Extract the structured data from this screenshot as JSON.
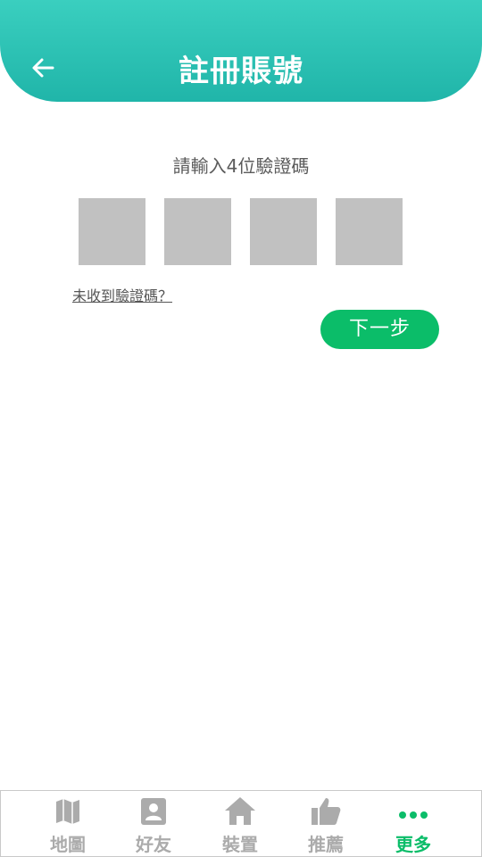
{
  "header": {
    "title": "註冊賬號",
    "back_icon": "arrow-left-icon"
  },
  "verify": {
    "prompt": "請輸入4位驗證碼",
    "code_digits": [
      "",
      "",
      "",
      ""
    ],
    "resend_link": "未收到驗證碼？",
    "next_button": "下一步"
  },
  "tabbar": {
    "items": [
      {
        "label": "地圖",
        "icon": "map-icon",
        "active": false
      },
      {
        "label": "好友",
        "icon": "contact-icon",
        "active": false
      },
      {
        "label": "裝置",
        "icon": "home-icon",
        "active": false
      },
      {
        "label": "推薦",
        "icon": "thumbs-up-icon",
        "active": false
      },
      {
        "label": "更多",
        "icon": "more-dots-icon",
        "active": true
      }
    ]
  },
  "colors": {
    "header": "#20b5a9",
    "accent": "#0bbd69",
    "inactive": "#ababab",
    "box": "#c1c1c1"
  }
}
